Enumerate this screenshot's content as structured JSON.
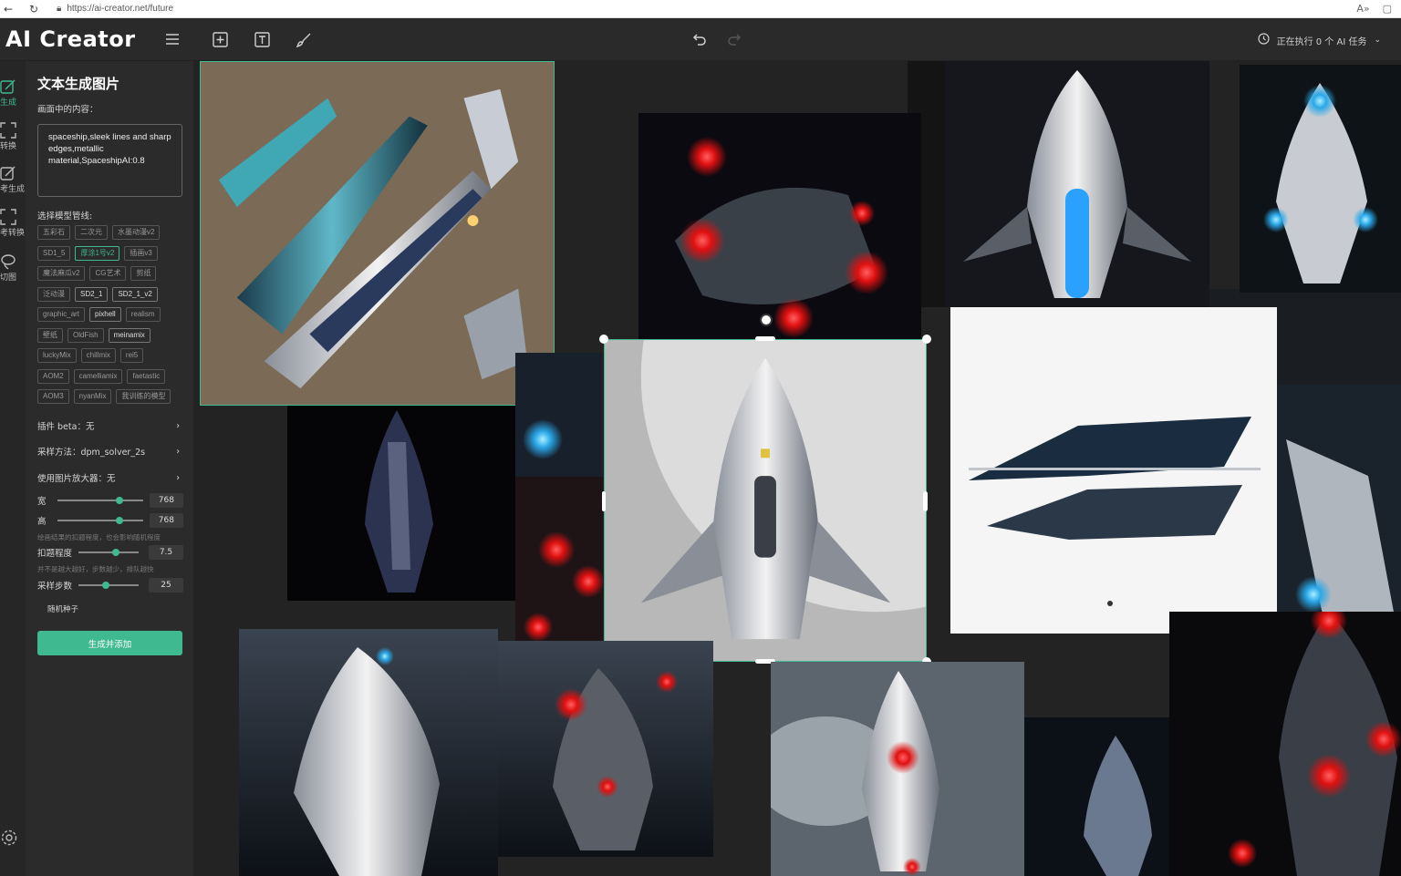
{
  "browser": {
    "url": "https://ai-creator.net/future"
  },
  "app": {
    "logo": "AI Creator",
    "task_status": "正在执行 0 个 AI 任务"
  },
  "icons": {
    "menu": "menu-icon",
    "add": "add-square-icon",
    "text": "text-box-icon",
    "brush": "brush-icon",
    "undo": "undo-icon",
    "redo": "redo-icon",
    "clock": "clock-icon",
    "settings": "gear-icon"
  },
  "leftnav": [
    {
      "label": "生成",
      "active": true
    },
    {
      "label": "转换",
      "active": false
    },
    {
      "label": "考生成",
      "active": false
    },
    {
      "label": "考转换",
      "active": false
    },
    {
      "label": "切图",
      "active": false
    }
  ],
  "panel": {
    "title": "文本生成图片",
    "content_label": "画面中的内容：",
    "prompt": "spaceship,sleek lines and sharp edges,metallic material,SpaceshipAI:0.8",
    "model_label": "选择模型管线:",
    "models": [
      [
        {
          "name": "五彩石",
          "state": "normal"
        },
        {
          "name": "二次元",
          "state": "normal"
        },
        {
          "name": "水墨动漫v2",
          "state": "normal"
        }
      ],
      [
        {
          "name": "SD1_5",
          "state": "normal"
        },
        {
          "name": "厚涂1号v2",
          "state": "active"
        },
        {
          "name": "插画v3",
          "state": "normal"
        }
      ],
      [
        {
          "name": "魔法麻瓜v2",
          "state": "normal"
        },
        {
          "name": "CG艺术",
          "state": "normal"
        },
        {
          "name": "剪纸",
          "state": "normal"
        }
      ],
      [
        {
          "name": "泛动漫",
          "state": "normal"
        },
        {
          "name": "SD2_1",
          "state": "bright"
        },
        {
          "name": "SD2_1_v2",
          "state": "bright"
        }
      ],
      [
        {
          "name": "graphic_art",
          "state": "normal"
        },
        {
          "name": "pixhell",
          "state": "bright"
        },
        {
          "name": "realism",
          "state": "normal"
        }
      ],
      [
        {
          "name": "壁纸",
          "state": "normal"
        },
        {
          "name": "OldFish",
          "state": "normal"
        },
        {
          "name": "meinamix",
          "state": "bright"
        }
      ],
      [
        {
          "name": "luckyMix",
          "state": "normal"
        },
        {
          "name": "chillmix",
          "state": "normal"
        },
        {
          "name": "rei5",
          "state": "normal"
        }
      ],
      [
        {
          "name": "AOM2",
          "state": "normal"
        },
        {
          "name": "camelliamix",
          "state": "normal"
        },
        {
          "name": "faetastic",
          "state": "normal"
        }
      ],
      [
        {
          "name": "AOM3",
          "state": "normal"
        },
        {
          "name": "nyanMix",
          "state": "normal"
        },
        {
          "name": "我训练的模型",
          "state": "normal"
        }
      ]
    ],
    "plugin": "插件 beta：无",
    "sampler": "采样方法：dpm_solver_2s",
    "upscaler": "使用图片放大器：无",
    "width_label": "宽",
    "width_value": "768",
    "width_level": 0.73,
    "height_label": "高",
    "height_value": "768",
    "height_level": 0.73,
    "hint1": "绘画结果的扣题程度，也会影响随机程度",
    "guidance_label": "扣题程度",
    "guidance_value": "7.5",
    "guidance_level": 0.62,
    "hint2": "并不是越大越好，步数越少，排队越快",
    "steps_label": "采样步数",
    "steps_value": "25",
    "steps_level": 0.45,
    "seed_label": "随机种子",
    "generate_label": "生成并添加"
  },
  "colors": {
    "accent": "#3fb98f",
    "background": "#1f1f1f",
    "panel": "#2b2b2b"
  }
}
